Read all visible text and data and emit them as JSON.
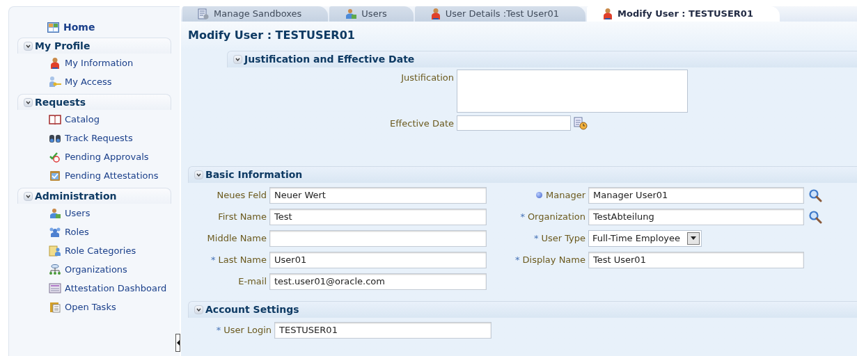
{
  "sidebar": {
    "home": "Home",
    "sections": [
      {
        "title": "My Profile",
        "expanded": true,
        "items": [
          "My Information",
          "My Access"
        ]
      },
      {
        "title": "Requests",
        "expanded": true,
        "items": [
          "Catalog",
          "Track Requests",
          "Pending Approvals",
          "Pending Attestations"
        ]
      },
      {
        "title": "Administration",
        "expanded": true,
        "items": [
          "Users",
          "Roles",
          "Role Categories",
          "Organizations",
          "Attestation Dashboard",
          "Open Tasks"
        ]
      }
    ]
  },
  "tabs": [
    {
      "label": "Manage Sandboxes",
      "selected": false
    },
    {
      "label": "Users",
      "selected": false
    },
    {
      "label": "User Details :Test User01",
      "selected": false
    },
    {
      "label": "Modify User : TESTUSER01",
      "selected": true
    }
  ],
  "page_title": "Modify User : TESTUSER01",
  "justification_section": {
    "title": "Justification and Effective Date",
    "expanded": true,
    "fields": [
      {
        "kind": "textarea",
        "label": "Justification"
      },
      {
        "kind": "date",
        "label": "Effective Date"
      }
    ]
  },
  "basic_section": {
    "title": "Basic Information",
    "expanded": true,
    "left_fields": [
      {
        "kind": "text",
        "label": "Neues Feld",
        "value": "Neuer Wert"
      },
      {
        "kind": "text",
        "label": "First Name",
        "value": "Test"
      },
      {
        "kind": "text",
        "label": "Middle Name"
      },
      {
        "kind": "text",
        "label": "Last Name",
        "value": "User01",
        "required_mark": "*"
      },
      {
        "kind": "text",
        "label": "E-mail",
        "value": "test.user01@oracle.com"
      }
    ],
    "right_fields": [
      {
        "kind": "lookup",
        "label": "Manager",
        "value": "Manager User01",
        "info_dot": true
      },
      {
        "kind": "lookup",
        "label": "Organization",
        "value": "TestAbteilung",
        "required_mark": "*"
      },
      {
        "kind": "select",
        "label": "User Type",
        "value": "Full-Time Employee",
        "required_mark": "*"
      },
      {
        "kind": "text",
        "label": "Display Name",
        "value": "Test User01",
        "required_mark": "*"
      }
    ]
  },
  "account_section": {
    "title": "Account Settings",
    "expanded": true,
    "fields": [
      {
        "kind": "text",
        "label": "User Login",
        "value": "TESTUSER01",
        "required_mark": "*"
      }
    ]
  }
}
